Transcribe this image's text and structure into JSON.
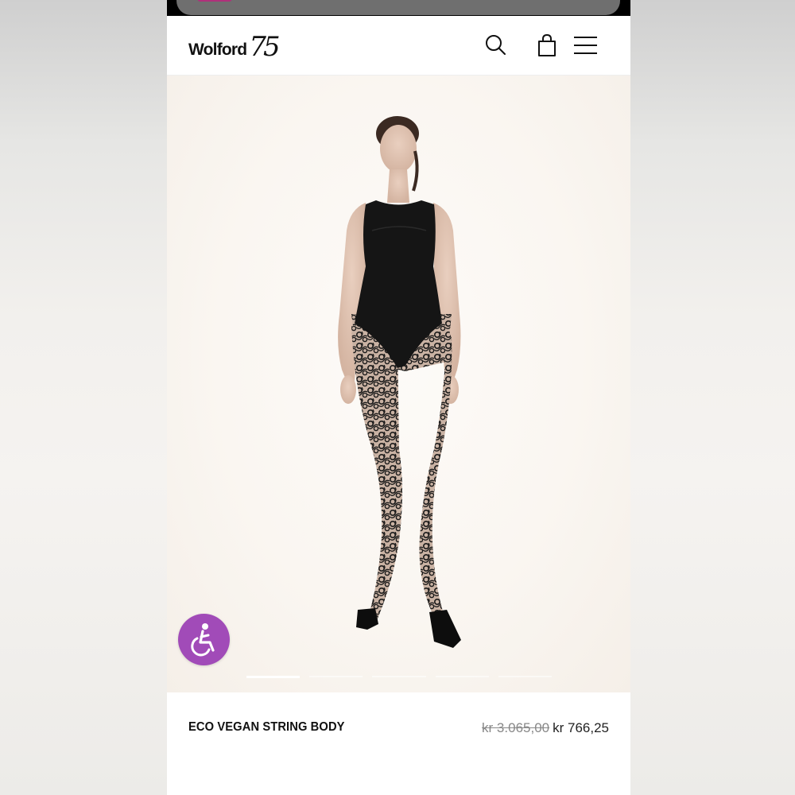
{
  "header": {
    "logo_word": "Wolford",
    "logo_number": "75",
    "icons": [
      "search-icon",
      "shopping-bag-icon",
      "hamburger-menu-icon"
    ]
  },
  "gallery": {
    "slide_count": 5,
    "active_slide": 1
  },
  "product": {
    "name": "ECO VEGAN STRING BODY",
    "original_price": "kr 3.065,00",
    "sale_price": "kr 766,25"
  },
  "accessibility": {
    "icon": "wheelchair-accessibility-icon",
    "color": "#a14bb8"
  },
  "colors": {
    "accent": "#a14bb8",
    "text": "#111111",
    "strike": "#888888"
  }
}
